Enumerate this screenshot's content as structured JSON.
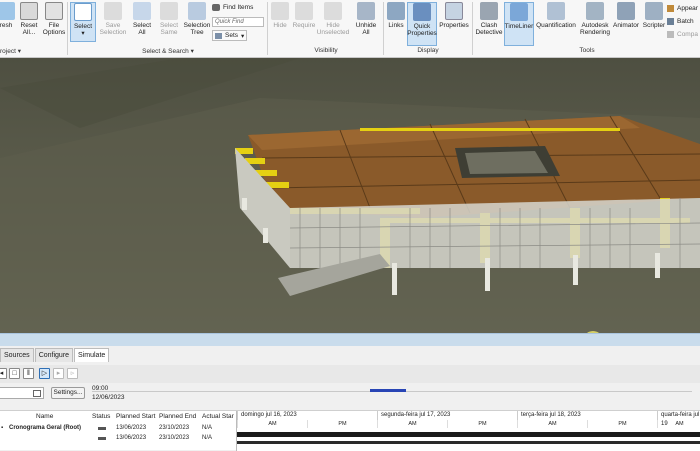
{
  "ribbon": {
    "buttons": [
      {
        "label": "resh",
        "label2": ""
      },
      {
        "label": "Reset",
        "label2": "All..."
      },
      {
        "label": "File",
        "label2": "Options"
      },
      {
        "label": "Select",
        "label2": ""
      },
      {
        "label": "Save",
        "label2": "Selection"
      },
      {
        "label": "Select",
        "label2": "All"
      },
      {
        "label": "Select",
        "label2": "Same"
      },
      {
        "label": "Selection",
        "label2": "Tree"
      },
      {
        "label": "Hide",
        "label2": ""
      },
      {
        "label": "Require",
        "label2": ""
      },
      {
        "label": "Hide",
        "label2": "Unselected"
      },
      {
        "label": "Unhide",
        "label2": "All"
      },
      {
        "label": "Links",
        "label2": ""
      },
      {
        "label": "Quick",
        "label2": "Properties"
      },
      {
        "label": "Properties",
        "label2": ""
      },
      {
        "label": "Clash",
        "label2": "Detective"
      },
      {
        "label": "TimeLiner",
        "label2": ""
      },
      {
        "label": "Quantification",
        "label2": ""
      },
      {
        "label": "Autodesk",
        "label2": "Rendering"
      },
      {
        "label": "Animator",
        "label2": ""
      },
      {
        "label": "Scripter",
        "label2": ""
      }
    ],
    "find_items": "Find Items",
    "quick_find": "Quick Find",
    "sets": "Sets",
    "appear": "Appear",
    "batch": "Batch",
    "compa": "Compa",
    "groups": {
      "project": "roject",
      "select_search": "Select & Search",
      "visibility": "Visibility",
      "display": "Display",
      "tools": "Tools"
    }
  },
  "timeliner": {
    "tabs": [
      "Sources",
      "Configure",
      "Simulate"
    ],
    "time": "09:00",
    "date": "12/06/2023",
    "settings_label": "Settings...",
    "columns": [
      "Name",
      "Status",
      "Planned Start",
      "Planned End",
      "Actual Star"
    ],
    "rows": [
      {
        "name": "Cronograma Geral (Root)",
        "planned_start": "13/06/2023",
        "planned_end": "23/10/2023",
        "actual_start": "N/A"
      },
      {
        "name": "",
        "planned_start": "13/06/2023",
        "planned_end": "23/10/2023",
        "actual_start": "N/A"
      }
    ],
    "gantt_days": [
      "domingo jul 16, 2023",
      "segunda-feira jul 17, 2023",
      "terça-feira jul 18, 2023",
      "quarta-feira jul 19"
    ],
    "am": "AM",
    "pm": "PM"
  }
}
